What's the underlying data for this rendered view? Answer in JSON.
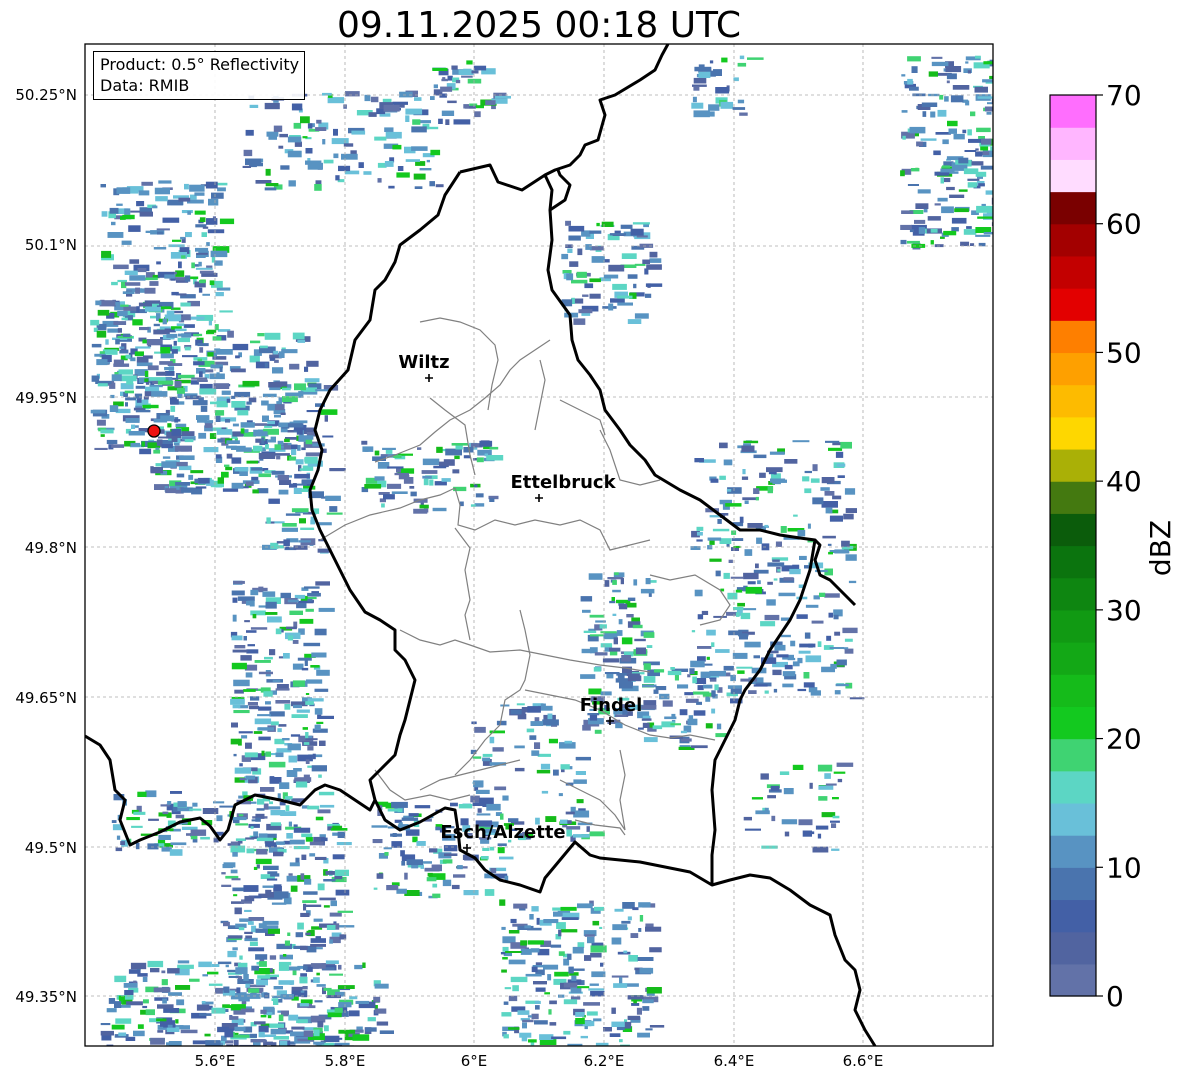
{
  "title": "09.11.2025 00:18 UTC",
  "info_box": {
    "product_line": "Product: 0.5° Reflectivity",
    "data_line": "Data: RMIB"
  },
  "axes": {
    "lon_labels": [
      "5.6°E",
      "5.8°E",
      "6°E",
      "6.2°E",
      "6.4°E",
      "6.6°E"
    ],
    "lat_labels": [
      "50.25°N",
      "50.1°N",
      "49.95°N",
      "49.8°N",
      "49.65°N",
      "49.5°N",
      "49.35°N"
    ]
  },
  "cities": [
    {
      "name": "Wiltz",
      "lon": 5.93,
      "lat": 49.968
    },
    {
      "name": "Ettelbruck",
      "lon": 6.1,
      "lat": 49.848
    },
    {
      "name": "Findel",
      "lon": 6.21,
      "lat": 49.627
    },
    {
      "name": "Esch/Alzette",
      "lon": 5.99,
      "lat": 49.499
    }
  ],
  "radar_site_color": "#ee1111",
  "colorbar": {
    "label": "dBZ",
    "ticks": [
      "0",
      "10",
      "20",
      "30",
      "40",
      "50",
      "60",
      "70"
    ],
    "min": 0,
    "max": 70,
    "step": 2.5,
    "colors": [
      "#6272a8",
      "#5164a0",
      "#4360a6",
      "#4a74ae",
      "#5893c2",
      "#69c0d9",
      "#5cd6c4",
      "#3fd372",
      "#13c91f",
      "#15bb1a",
      "#13a816",
      "#119a13",
      "#0e8611",
      "#0b740e",
      "#0b5c0b",
      "#447910",
      "#aab006",
      "#fed700",
      "#fdbb00",
      "#fea000",
      "#fe7f00",
      "#e30000",
      "#c30000",
      "#a30000",
      "#7a0000",
      "#ffdcff",
      "#ffb6ff",
      "#ff6efe",
      "#ec3aef"
    ]
  }
}
